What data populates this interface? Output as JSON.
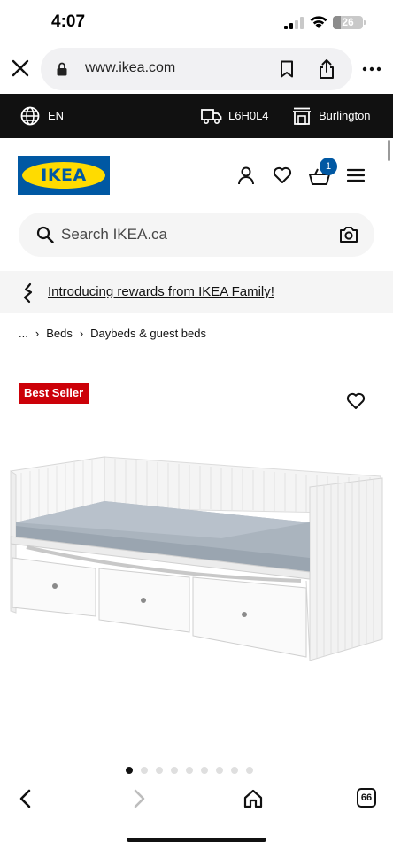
{
  "status_bar": {
    "time": "4:07",
    "battery": "26"
  },
  "browser": {
    "url": "www.ikea.com"
  },
  "info_bar": {
    "language": "EN",
    "postal_code": "L6H0L4",
    "store": "Burlington"
  },
  "header": {
    "logo_text": "IKEA",
    "cart_count": "1"
  },
  "search": {
    "placeholder": "Search IKEA.ca"
  },
  "rewards": {
    "text": "Introducing rewards from IKEA Family!"
  },
  "breadcrumb": {
    "ellipsis": "...",
    "items": [
      "Beds",
      "Daybeds & guest beds"
    ]
  },
  "product": {
    "badge": "Best Seller"
  },
  "carousel": {
    "total_images": 9,
    "active_index": 0
  },
  "toolbar": {
    "tab_count": "66"
  },
  "colors": {
    "ikea_blue": "#0058a3",
    "ikea_yellow": "#ffdb00",
    "badge_red": "#cc0008"
  }
}
